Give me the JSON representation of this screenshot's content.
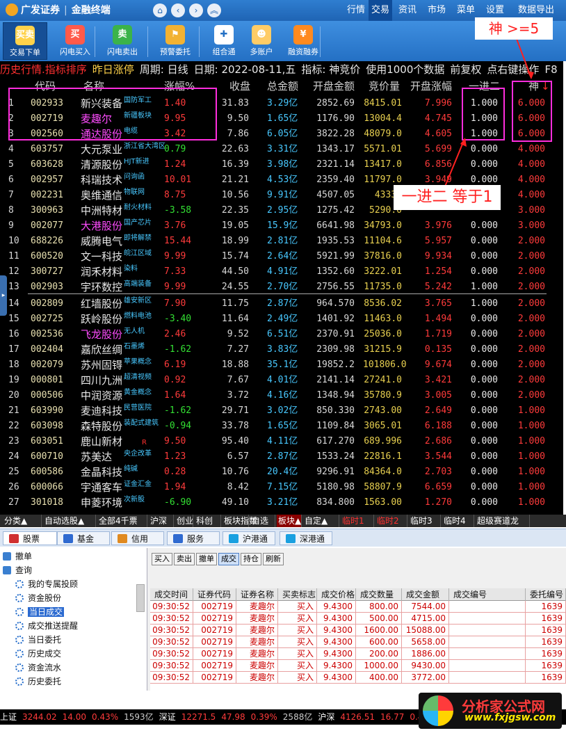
{
  "app": {
    "brand": "广发证券",
    "subtitle": "金融终端"
  },
  "topnav": [
    "行情",
    "交易",
    "资讯",
    "市场",
    "菜单",
    "设置",
    "数据导出"
  ],
  "topnav_active": "交易",
  "toolbar": [
    {
      "label": "交易下单",
      "icon": "order-icon",
      "glyph": "买卖",
      "color": "#ffd24a"
    },
    {
      "label": "闪电买入",
      "icon": "flash-buy-icon",
      "glyph": "买",
      "color": "#ff5a4a"
    },
    {
      "label": "闪电卖出",
      "icon": "flash-sell-icon",
      "glyph": "卖",
      "color": "#3bb34a"
    },
    {
      "label": "预警委托",
      "icon": "alarm-icon",
      "glyph": "⚑",
      "color": "#f2b233"
    },
    {
      "label": "组合通",
      "icon": "puzzle-icon",
      "glyph": "✚",
      "color": "#ffffff"
    },
    {
      "label": "多账户",
      "icon": "users-icon",
      "glyph": "☻",
      "color": "#ffcc66"
    },
    {
      "label": "融资融券",
      "icon": "finance-icon",
      "glyph": "¥",
      "color": "#ff8a1f"
    }
  ],
  "infobar": [
    "历史行情.指标排序",
    "昨日涨停",
    "周期: 日线",
    "日期: 2022-08-11,五",
    "指标: 神竞价",
    "使用1000个数据",
    "前复权",
    "点右键操作",
    "F8"
  ],
  "grid": {
    "headers": [
      "代码",
      "名称",
      "涨幅%",
      "收盘",
      "总金额",
      "开盘金额",
      "竞价量",
      "开盘涨幅",
      "一进二",
      "神"
    ],
    "rows": [
      {
        "idx": "1",
        "code": "002933",
        "name": "新兴装备",
        "tag": "国防军工",
        "chg": "1.40",
        "close": "31.83",
        "amt": "3.29亿",
        "open": "2852.69",
        "bid": "8415.01",
        "opc": "7.996",
        "j2": "1.000",
        "sh": "6.000",
        "nc": "#e8e8e8",
        "cc": "#ff3b3b"
      },
      {
        "idx": "2",
        "code": "002719",
        "name": "麦趣尔",
        "tag": "新疆板块",
        "chg": "9.95",
        "close": "9.50",
        "amt": "1.65亿",
        "open": "1176.90",
        "bid": "13004.4",
        "opc": "4.745",
        "j2": "1.000",
        "sh": "6.000",
        "nc": "#ff4cff",
        "cc": "#ff3b3b"
      },
      {
        "idx": "3",
        "code": "002560",
        "name": "通达股份",
        "tag": "电缆",
        "chg": "3.42",
        "close": "7.86",
        "amt": "6.05亿",
        "open": "3822.28",
        "bid": "48079.0",
        "opc": "4.605",
        "j2": "1.000",
        "sh": "6.000",
        "nc": "#ff4cff",
        "cc": "#ff3b3b"
      },
      {
        "idx": "4",
        "code": "603757",
        "name": "大元泵业",
        "tag": "浙江省大湾区",
        "chg": "0.79",
        "close": "22.63",
        "amt": "3.31亿",
        "open": "1343.17",
        "bid": "5571.01",
        "opc": "5.699",
        "j2": "0.000",
        "sh": "4.000",
        "nc": "#e8e8e8",
        "cc": "#33e033"
      },
      {
        "idx": "5",
        "code": "603628",
        "name": "清源股份",
        "tag": "HJT新进",
        "chg": "1.24",
        "close": "16.39",
        "amt": "3.98亿",
        "open": "2321.14",
        "bid": "13417.0",
        "opc": "6.856",
        "j2": "0.000",
        "sh": "4.000",
        "nc": "#e8e8e8",
        "cc": "#ff3b3b"
      },
      {
        "idx": "6",
        "code": "002957",
        "name": "科瑞技术",
        "tag": "问询函",
        "chg": "10.01",
        "close": "21.21",
        "amt": "4.53亿",
        "open": "2359.40",
        "bid": "11797.0",
        "opc": "3.949",
        "j2": "0.000",
        "sh": "4.000",
        "nc": "#e8e8e8",
        "cc": "#ff3b3b"
      },
      {
        "idx": "7",
        "code": "002231",
        "name": "奥维通信",
        "tag": "物联网",
        "chg": "8.75",
        "close": "10.56",
        "amt": "9.91亿",
        "open": "4507.05",
        "bid": "43337",
        "opc": "",
        "j2": "",
        "sh": "4.000",
        "nc": "#e8e8e8",
        "cc": "#ff3b3b"
      },
      {
        "idx": "8",
        "code": "300963",
        "name": "中洲特材",
        "tag": "耐火材料",
        "chg": "-3.58",
        "close": "22.35",
        "amt": "2.95亿",
        "open": "1275.42",
        "bid": "5290.0",
        "opc": "",
        "j2": "",
        "sh": "3.000",
        "nc": "#e8e8e8",
        "cc": "#33e033"
      },
      {
        "idx": "9",
        "code": "002077",
        "name": "大港股份",
        "tag": "国产芯片",
        "chg": "3.76",
        "close": "19.05",
        "amt": "15.9亿",
        "open": "6641.98",
        "bid": "34793.0",
        "opc": "3.976",
        "j2": "0.000",
        "sh": "3.000",
        "nc": "#ff4cff",
        "cc": "#ff3b3b"
      },
      {
        "idx": "10",
        "code": "688226",
        "name": "威腾电气",
        "tag": "即将解禁",
        "chg": "15.44",
        "close": "18.99",
        "amt": "2.81亿",
        "open": "1935.53",
        "bid": "11104.6",
        "opc": "5.957",
        "j2": "0.000",
        "sh": "2.000",
        "nc": "#e8e8e8",
        "cc": "#ff3b3b"
      },
      {
        "idx": "11",
        "code": "600520",
        "name": "文一科技",
        "tag": "皖江区域",
        "chg": "9.99",
        "close": "15.74",
        "amt": "2.64亿",
        "open": "5921.99",
        "bid": "37816.0",
        "opc": "9.934",
        "j2": "0.000",
        "sh": "2.000",
        "nc": "#e8e8e8",
        "cc": "#ff3b3b"
      },
      {
        "idx": "12",
        "code": "300727",
        "name": "润禾材料",
        "tag": "染料",
        "chg": "7.33",
        "close": "44.50",
        "amt": "4.91亿",
        "open": "1352.60",
        "bid": "3222.01",
        "opc": "1.254",
        "j2": "0.000",
        "sh": "2.000",
        "nc": "#e8e8e8",
        "cc": "#ff3b3b"
      },
      {
        "idx": "13",
        "code": "002903",
        "name": "宇环数控",
        "tag": "高端装备",
        "chg": "9.99",
        "close": "24.55",
        "amt": "2.70亿",
        "open": "2756.55",
        "bid": "11735.0",
        "opc": "5.242",
        "j2": "1.000",
        "sh": "2.000",
        "nc": "#e8e8e8",
        "cc": "#ff3b3b"
      },
      {
        "idx": "14",
        "code": "002809",
        "name": "红墙股份",
        "tag": "雄安新区",
        "chg": "7.90",
        "close": "11.75",
        "amt": "2.87亿",
        "open": "964.570",
        "bid": "8536.02",
        "opc": "3.765",
        "j2": "1.000",
        "sh": "2.000",
        "nc": "#e8e8e8",
        "cc": "#ff3b3b"
      },
      {
        "idx": "15",
        "code": "002725",
        "name": "跃岭股份",
        "tag": "燃料电池",
        "chg": "-3.40",
        "close": "11.64",
        "amt": "2.49亿",
        "open": "1401.92",
        "bid": "11463.0",
        "opc": "1.494",
        "j2": "0.000",
        "sh": "2.000",
        "nc": "#e8e8e8",
        "cc": "#33e033"
      },
      {
        "idx": "16",
        "code": "002536",
        "name": "飞龙股份",
        "tag": "无人机",
        "chg": "2.46",
        "close": "9.52",
        "amt": "6.51亿",
        "open": "2370.91",
        "bid": "25036.0",
        "opc": "1.719",
        "j2": "0.000",
        "sh": "2.000",
        "nc": "#ff4cff",
        "cc": "#ff3b3b"
      },
      {
        "idx": "17",
        "code": "002404",
        "name": "嘉欣丝绸",
        "tag": "石墨烯",
        "chg": "-1.62",
        "close": "7.27",
        "amt": "3.83亿",
        "open": "2309.98",
        "bid": "31215.9",
        "opc": "0.135",
        "j2": "0.000",
        "sh": "2.000",
        "nc": "#e8e8e8",
        "cc": "#33e033"
      },
      {
        "idx": "18",
        "code": "002079",
        "name": "苏州固锝",
        "tag": "苹果概念",
        "chg": "6.19",
        "close": "18.88",
        "amt": "35.1亿",
        "open": "19852.2",
        "bid": "101806.0",
        "opc": "9.674",
        "j2": "0.000",
        "sh": "2.000",
        "nc": "#e8e8e8",
        "cc": "#ff3b3b"
      },
      {
        "idx": "19",
        "code": "000801",
        "name": "四川九洲",
        "tag": "超清视频",
        "chg": "0.92",
        "close": "7.67",
        "amt": "4.01亿",
        "open": "2141.14",
        "bid": "27241.0",
        "opc": "3.421",
        "j2": "0.000",
        "sh": "2.000",
        "nc": "#e8e8e8",
        "cc": "#ff3b3b"
      },
      {
        "idx": "20",
        "code": "000506",
        "name": "中润资源",
        "tag": "黄金概念",
        "chg": "1.64",
        "close": "3.72",
        "amt": "4.16亿",
        "open": "1348.94",
        "bid": "35780.9",
        "opc": "3.005",
        "j2": "0.000",
        "sh": "2.000",
        "nc": "#e8e8e8",
        "cc": "#ff3b3b"
      },
      {
        "idx": "21",
        "code": "603990",
        "name": "麦迪科技",
        "tag": "民营医院",
        "chg": "-1.62",
        "close": "29.71",
        "amt": "3.02亿",
        "open": "850.330",
        "bid": "2743.00",
        "opc": "2.649",
        "j2": "0.000",
        "sh": "1.000",
        "nc": "#e8e8e8",
        "cc": "#33e033"
      },
      {
        "idx": "22",
        "code": "603098",
        "name": "森特股份",
        "tag": "装配式建筑",
        "chg": "-0.94",
        "close": "33.78",
        "amt": "1.65亿",
        "open": "1109.84",
        "bid": "3065.01",
        "opc": "6.188",
        "j2": "0.000",
        "sh": "1.000",
        "nc": "#e8e8e8",
        "cc": "#33e033"
      },
      {
        "idx": "23",
        "code": "603051",
        "name": "鹿山新材",
        "tag": "R",
        "chg": "9.50",
        "close": "95.40",
        "amt": "4.11亿",
        "open": "617.270",
        "bid": "689.996",
        "opc": "2.686",
        "j2": "0.000",
        "sh": "1.000",
        "nc": "#e8e8e8",
        "cc": "#ff3b3b"
      },
      {
        "idx": "24",
        "code": "600710",
        "name": "苏美达",
        "tag": "央企改革",
        "chg": "1.23",
        "close": "6.57",
        "amt": "2.87亿",
        "open": "1533.24",
        "bid": "22816.1",
        "opc": "3.544",
        "j2": "0.000",
        "sh": "1.000",
        "nc": "#e8e8e8",
        "cc": "#ff3b3b"
      },
      {
        "idx": "25",
        "code": "600586",
        "name": "金晶科技",
        "tag": "纯碱",
        "chg": "0.28",
        "close": "10.76",
        "amt": "20.4亿",
        "open": "9296.91",
        "bid": "84364.0",
        "opc": "2.703",
        "j2": "0.000",
        "sh": "1.000",
        "nc": "#e8e8e8",
        "cc": "#ff3b3b"
      },
      {
        "idx": "26",
        "code": "600066",
        "name": "宇通客车",
        "tag": "证金汇金",
        "chg": "1.94",
        "close": "8.42",
        "amt": "7.15亿",
        "open": "5180.98",
        "bid": "58807.9",
        "opc": "6.659",
        "j2": "0.000",
        "sh": "1.000",
        "nc": "#e8e8e8",
        "cc": "#ff3b3b"
      },
      {
        "idx": "27",
        "code": "301018",
        "name": "申菱环境",
        "tag": "次新股",
        "chg": "-6.90",
        "close": "49.10",
        "amt": "3.21亿",
        "open": "834.800",
        "bid": "1563.00",
        "opc": "1.270",
        "j2": "0.000",
        "sh": "1.000",
        "nc": "#e8e8e8",
        "cc": "#33e033"
      }
    ]
  },
  "annotations": {
    "shen": "神 >=5",
    "j2": "一进二 等于1"
  },
  "catbar": [
    "分类▲",
    "自动选股▲",
    "全部4千票",
    "沪深",
    "创业",
    "科创",
    "板块指数",
    "自选",
    "板块▲",
    "自定▲",
    "临时1",
    "临时2",
    "临时3",
    "临时4",
    "超级赛道",
    "龙"
  ],
  "lowtabs": [
    "股票",
    "基金",
    "信用",
    "服务",
    "沪港通",
    "深港通"
  ],
  "tree": [
    "撤单",
    "查询",
    "我的专属投顾",
    "资金股份",
    "当日成交",
    "成交推送提醒",
    "当日委托",
    "历史成交",
    "资金流水",
    "历史委托"
  ],
  "actions": [
    "买入",
    "卖出",
    "撤单",
    "成交",
    "持仓",
    "刷新"
  ],
  "table": {
    "headers": [
      "成交时间",
      "证券代码",
      "证券名称",
      "买卖标志",
      "成交价格",
      "成交数量",
      "成交金额",
      "成交编号",
      "委托编号"
    ],
    "rows": [
      [
        "09:30:52",
        "002719",
        "麦趣尔",
        "买入",
        "9.4300",
        "800.00",
        "7544.00",
        "",
        "1639"
      ],
      [
        "09:30:52",
        "002719",
        "麦趣尔",
        "买入",
        "9.4300",
        "500.00",
        "4715.00",
        "",
        "1639"
      ],
      [
        "09:30:52",
        "002719",
        "麦趣尔",
        "买入",
        "9.4300",
        "1600.00",
        "15088.00",
        "",
        "1639"
      ],
      [
        "09:30:52",
        "002719",
        "麦趣尔",
        "买入",
        "9.4300",
        "600.00",
        "5658.00",
        "",
        "1639"
      ],
      [
        "09:30:52",
        "002719",
        "麦趣尔",
        "买入",
        "9.4300",
        "200.00",
        "1886.00",
        "",
        "1639"
      ],
      [
        "09:30:52",
        "002719",
        "麦趣尔",
        "买入",
        "9.4300",
        "1000.00",
        "9430.00",
        "",
        "1639"
      ],
      [
        "09:30:52",
        "002719",
        "麦趣尔",
        "买入",
        "9.4300",
        "400.00",
        "3772.00",
        "",
        "1639"
      ]
    ]
  },
  "status": [
    "上证",
    "3244.02",
    "14.00",
    "0.43%",
    "1593亿",
    "深证",
    "12271.5",
    "47.98",
    "0.39%",
    "2588亿",
    "沪深",
    "4126.51",
    "16.77",
    "0.41"
  ],
  "watermark": {
    "cn": "分析家公式网",
    "url": "www.fxjgsw.com"
  }
}
